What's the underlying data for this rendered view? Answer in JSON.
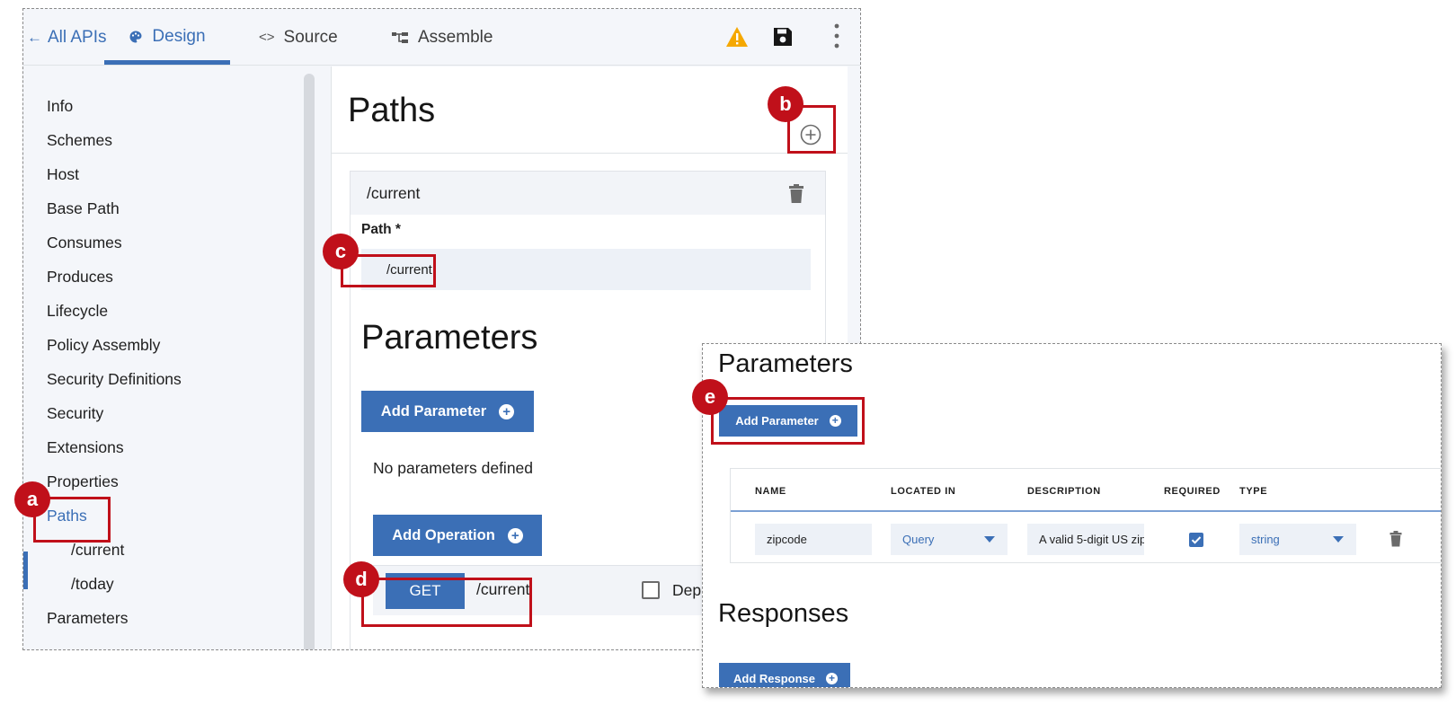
{
  "topbar": {
    "back_label": "All APIs",
    "tabs": [
      {
        "label": "Design",
        "icon": "palette-icon",
        "active": true
      },
      {
        "label": "Source",
        "icon": "code-icon",
        "active": false
      },
      {
        "label": "Assemble",
        "icon": "assemble-icon",
        "active": false
      }
    ],
    "icons": [
      "warning-icon",
      "save-icon",
      "more-options-icon"
    ]
  },
  "sidebar": {
    "items": [
      {
        "label": "Info"
      },
      {
        "label": "Schemes"
      },
      {
        "label": "Host"
      },
      {
        "label": "Base Path"
      },
      {
        "label": "Consumes"
      },
      {
        "label": "Produces"
      },
      {
        "label": "Lifecycle"
      },
      {
        "label": "Policy Assembly"
      },
      {
        "label": "Security Definitions"
      },
      {
        "label": "Security"
      },
      {
        "label": "Extensions"
      },
      {
        "label": "Properties"
      },
      {
        "label": "Paths",
        "active": true
      },
      {
        "label": "/current",
        "sub": true
      },
      {
        "label": "/today",
        "sub": true
      },
      {
        "label": "Parameters"
      }
    ]
  },
  "content": {
    "title": "Paths",
    "path_card": {
      "title": "/current",
      "path_label": "Path *",
      "path_value": "/current",
      "parameters_title": "Parameters",
      "add_parameter_label": "Add Parameter",
      "no_parameters": "No parameters defined",
      "add_operation_label": "Add Operation",
      "operation": {
        "method": "GET",
        "path": "/current",
        "deprecated_label": "Dep"
      }
    }
  },
  "detail": {
    "parameters_title": "Parameters",
    "add_parameter_label": "Add Parameter",
    "table": {
      "headers": [
        "NAME",
        "LOCATED IN",
        "DESCRIPTION",
        "REQUIRED",
        "TYPE"
      ],
      "rows": [
        {
          "name": "zipcode",
          "located_in": "Query",
          "description": "A valid 5-digit US zip",
          "required": true,
          "type": "string"
        }
      ]
    },
    "responses_title": "Responses",
    "add_response_label": "Add Response"
  },
  "annotations": [
    "a",
    "b",
    "c",
    "d",
    "e"
  ],
  "colors": {
    "accent": "#3b6fb6",
    "highlight": "#c0101a",
    "warning": "#f5a800"
  }
}
